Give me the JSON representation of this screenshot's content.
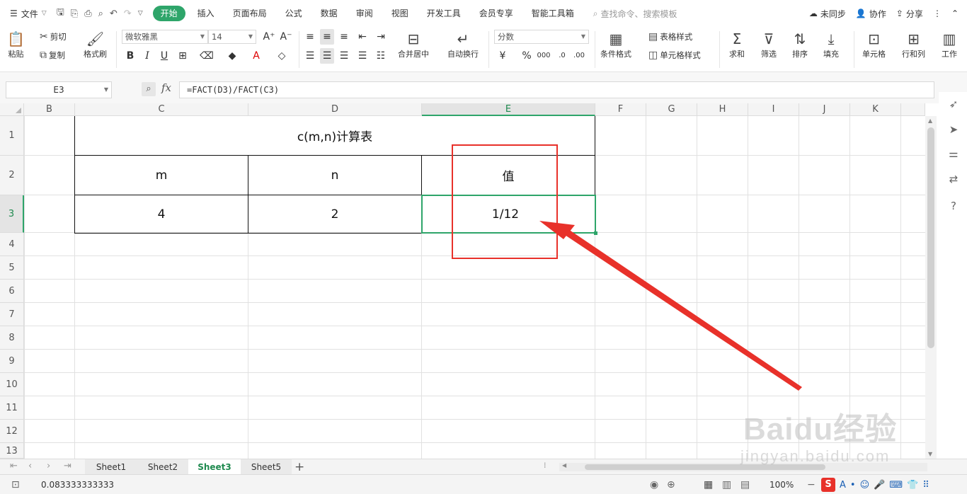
{
  "menubar": {
    "file_label": "文件",
    "tabs": [
      "开始",
      "插入",
      "页面布局",
      "公式",
      "数据",
      "审阅",
      "视图",
      "开发工具",
      "会员专享",
      "智能工具箱"
    ],
    "search_placeholder": "查找命令、搜索模板",
    "sync_label": "未同步",
    "collab_label": "协作",
    "share_label": "分享"
  },
  "ribbon": {
    "paste": "粘贴",
    "cut": "剪切",
    "copy": "复制",
    "format_painter": "格式刷",
    "font_name": "微软雅黑",
    "font_size": "14",
    "merge_center": "合并居中",
    "wrap_text": "自动换行",
    "number_format": "分数",
    "conditional_format": "条件格式",
    "table_style": "表格样式",
    "cell_style": "单元格样式",
    "sum": "求和",
    "filter": "筛选",
    "sort": "排序",
    "fill": "填充",
    "cells": "单元格",
    "rows_cols": "行和列",
    "worksheet": "工作"
  },
  "formula_bar": {
    "name_box": "E3",
    "fx": "fx",
    "formula": "=FACT(D3)/FACT(C3)"
  },
  "grid": {
    "columns": [
      "B",
      "C",
      "D",
      "E",
      "F",
      "G",
      "H",
      "I",
      "J",
      "K"
    ],
    "rows": [
      "1",
      "2",
      "3",
      "4",
      "5",
      "6",
      "7",
      "8",
      "9",
      "10",
      "11",
      "12",
      "13"
    ],
    "selected_column": "E",
    "selected_row": "3"
  },
  "table": {
    "title": "c(m,n)计算表",
    "header_m": "m",
    "header_n": "n",
    "header_value": "值",
    "value_m": "4",
    "value_n": "2",
    "value_result": "1/12"
  },
  "sheets": {
    "tabs": [
      "Sheet1",
      "Sheet2",
      "Sheet3",
      "Sheet5"
    ],
    "active": "Sheet3"
  },
  "statusbar": {
    "value": "0.083333333333",
    "zoom": "100%"
  },
  "watermark": {
    "brand": "Baidu经验",
    "url": "jingyan.baidu.com"
  },
  "colors": {
    "accent_green": "#2ea56a",
    "annotation_red": "#e8312a"
  }
}
